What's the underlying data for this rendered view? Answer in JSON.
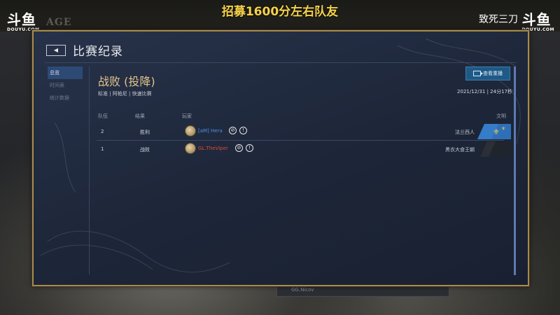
{
  "stream": {
    "banner": "招募1600分左右队友",
    "logo_left": "斗鱼",
    "logo_left_sub": "DOUYU.COM",
    "logo_right": "斗鱼",
    "logo_right_sub": "DOUYU.COM",
    "watermark": "致死三刀",
    "age_text": "AGE"
  },
  "header": {
    "back_icon": "arrow-left-icon",
    "title": "比赛纪录"
  },
  "sidebar": {
    "items": [
      {
        "label": "总览",
        "active": true
      },
      {
        "label": "时间表",
        "active": false
      },
      {
        "label": "统计数据",
        "active": false
      }
    ]
  },
  "summary": {
    "result": "战败 (投降)",
    "mode": "标准 | 阿帕尼 | 快速比赛",
    "replay_label": "查看重播",
    "datetime": "2021/12/31 | 24分17秒"
  },
  "table": {
    "headers": {
      "team": "队伍",
      "result": "结果",
      "player": "玩家",
      "civ": "文明"
    },
    "rows": [
      {
        "team": "2",
        "result": "胜利",
        "player": "[aM] Hera",
        "civ": "法兰西人",
        "player_color": "#4f8fe8"
      },
      {
        "team": "1",
        "result": "战败",
        "player": "GL.TheViper",
        "civ": "黑衣大食王朝",
        "player_color": "#e0473a"
      }
    ]
  },
  "footer": {
    "bar_text": "GG.Nicov"
  }
}
